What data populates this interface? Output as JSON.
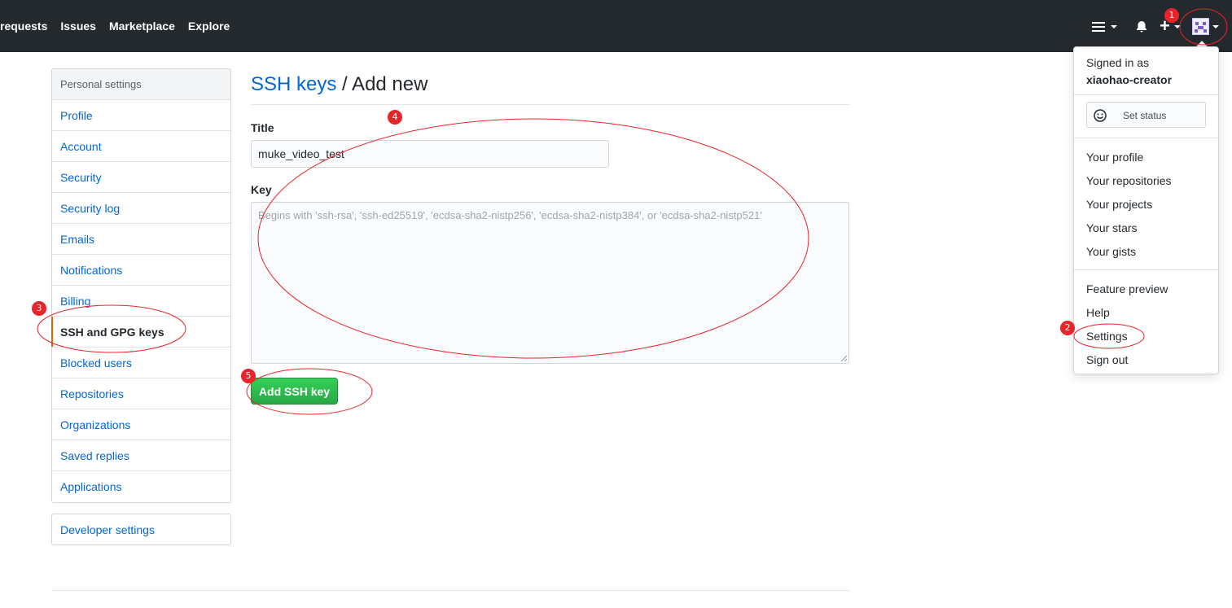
{
  "header": {
    "nav": [
      "requests",
      "Issues",
      "Marketplace",
      "Explore"
    ],
    "icons": [
      "menu-icon",
      "bell-icon",
      "plus-icon",
      "avatar"
    ]
  },
  "sidebar": {
    "heading": "Personal settings",
    "items": [
      {
        "label": "Profile"
      },
      {
        "label": "Account"
      },
      {
        "label": "Security"
      },
      {
        "label": "Security log"
      },
      {
        "label": "Emails"
      },
      {
        "label": "Notifications"
      },
      {
        "label": "Billing"
      },
      {
        "label": "SSH and GPG keys",
        "selected": true
      },
      {
        "label": "Blocked users"
      },
      {
        "label": "Repositories"
      },
      {
        "label": "Organizations"
      },
      {
        "label": "Saved replies"
      },
      {
        "label": "Applications"
      }
    ],
    "developer_settings": "Developer settings"
  },
  "main": {
    "breadcrumb_link": "SSH keys",
    "breadcrumb_rest": " / Add new",
    "title_label": "Title",
    "title_value": "muke_video_test",
    "key_label": "Key",
    "key_placeholder": "Begins with 'ssh-rsa', 'ssh-ed25519', 'ecdsa-sha2-nistp256', 'ecdsa-sha2-nistp384', or 'ecdsa-sha2-nistp521'",
    "submit_label": "Add SSH key"
  },
  "user_menu": {
    "signed_in_as": "Signed in as",
    "username": "xiaohao-creator",
    "set_status": "Set status",
    "group1": [
      "Your profile",
      "Your repositories",
      "Your projects",
      "Your stars",
      "Your gists"
    ],
    "group2": [
      "Feature preview",
      "Help",
      "Settings",
      "Sign out"
    ]
  },
  "annotations": {
    "badges": [
      "1",
      "2",
      "3",
      "4",
      "5"
    ],
    "color": "#e8232a"
  },
  "colors": {
    "header_bg": "#24292e",
    "link": "#0366d6",
    "selected_accent": "#e36209",
    "button_green": "#28a745"
  }
}
